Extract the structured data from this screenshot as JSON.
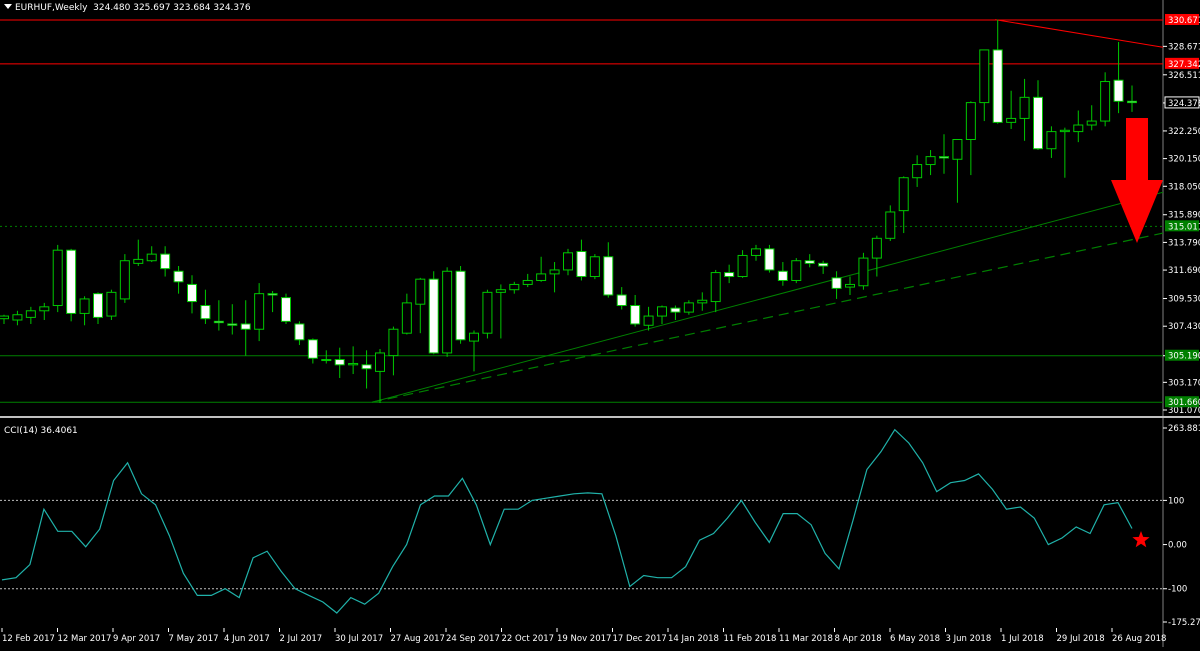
{
  "header": {
    "symbol": "EURHUF,Weekly",
    "ohlc": "324.480 325.697 323.684 324.376"
  },
  "price_axis": {
    "ticks": [
      "328.671",
      "326.511",
      "324.376",
      "322.250",
      "320.150",
      "318.050",
      "315.890",
      "313.790",
      "311.690",
      "309.530",
      "307.430",
      "305.190",
      "303.170",
      "301.070"
    ],
    "level_labels": [
      {
        "text": "330.671",
        "kind": "resistance",
        "color": "#ff0000"
      },
      {
        "text": "327.342",
        "kind": "resistance",
        "color": "#ff0000"
      },
      {
        "text": "315.011",
        "kind": "pivot",
        "color": "#008000"
      },
      {
        "text": "305.190",
        "kind": "support",
        "color": "#008000"
      },
      {
        "text": "301.660",
        "kind": "support",
        "color": "#008000"
      }
    ],
    "current_price": "324.376"
  },
  "cci": {
    "label": "CCI(14) 36.4061",
    "ticks": [
      "263.881",
      "100",
      "0.00",
      "-100",
      "-175.274"
    ]
  },
  "time_axis": {
    "labels": [
      "12 Feb 2017",
      "12 Mar 2017",
      "9 Apr 2017",
      "7 May 2017",
      "4 Jun 2017",
      "2 Jul 2017",
      "30 Jul 2017",
      "27 Aug 2017",
      "24 Sep 2017",
      "22 Oct 2017",
      "19 Nov 2017",
      "17 Dec 2017",
      "14 Jan 2018",
      "11 Feb 2018",
      "11 Mar 2018",
      "8 Apr 2018",
      "6 May 2018",
      "3 Jun 2018",
      "1 Jul 2018",
      "29 Jul 2018",
      "26 Aug 2018"
    ]
  },
  "colors": {
    "background": "#000000",
    "bull_body": "#000000",
    "bear_body": "#ffffff",
    "wick": "#00c800",
    "resistance": "#ff0000",
    "support": "#008000",
    "cci_line": "#20b2aa",
    "arrow": "#ff0000",
    "star": "#ff0000"
  },
  "chart_data": [
    {
      "type": "candlestick",
      "symbol": "EURHUF",
      "timeframe": "Weekly",
      "ylim": [
        301.07,
        330.67
      ],
      "candles": [
        [
          308.0,
          308.3,
          307.6,
          308.2
        ],
        [
          307.9,
          308.6,
          307.5,
          308.3
        ],
        [
          308.1,
          308.9,
          307.6,
          308.6
        ],
        [
          308.6,
          309.2,
          307.9,
          308.9
        ],
        [
          309.0,
          313.6,
          308.5,
          313.2
        ],
        [
          313.2,
          313.3,
          307.8,
          308.4
        ],
        [
          308.4,
          309.7,
          307.5,
          309.5
        ],
        [
          309.9,
          310.0,
          307.6,
          308.1
        ],
        [
          308.2,
          310.2,
          307.9,
          310.0
        ],
        [
          309.5,
          312.9,
          309.2,
          312.4
        ],
        [
          312.2,
          314.0,
          312.0,
          312.5
        ],
        [
          312.4,
          313.5,
          312.3,
          312.9
        ],
        [
          312.9,
          313.5,
          311.2,
          311.8
        ],
        [
          311.6,
          312.0,
          309.9,
          310.8
        ],
        [
          310.6,
          311.3,
          308.4,
          309.3
        ],
        [
          309.0,
          310.2,
          307.6,
          308.0
        ],
        [
          307.8,
          309.4,
          307.1,
          307.7
        ],
        [
          307.6,
          309.1,
          306.8,
          307.5
        ],
        [
          307.6,
          309.4,
          305.2,
          307.2
        ],
        [
          307.2,
          310.7,
          306.3,
          309.9
        ],
        [
          309.9,
          310.1,
          308.5,
          309.8
        ],
        [
          309.6,
          309.9,
          307.6,
          307.8
        ],
        [
          307.6,
          307.8,
          306.0,
          306.4
        ],
        [
          306.4,
          306.5,
          304.6,
          305.0
        ],
        [
          304.9,
          305.6,
          304.6,
          304.9
        ],
        [
          304.9,
          305.8,
          303.5,
          304.5
        ],
        [
          304.5,
          305.9,
          303.8,
          304.6
        ],
        [
          304.5,
          305.6,
          302.7,
          304.2
        ],
        [
          304.0,
          305.7,
          301.6,
          305.4
        ],
        [
          305.2,
          307.4,
          303.7,
          307.2
        ],
        [
          306.9,
          309.9,
          306.8,
          309.2
        ],
        [
          309.1,
          311.1,
          306.9,
          311.0
        ],
        [
          311.0,
          311.6,
          305.3,
          305.4
        ],
        [
          305.4,
          311.9,
          305.1,
          311.6
        ],
        [
          311.6,
          312.0,
          306.1,
          306.4
        ],
        [
          306.3,
          307.1,
          304.0,
          306.9
        ],
        [
          306.9,
          310.2,
          306.5,
          310.0
        ],
        [
          310.0,
          310.6,
          306.5,
          310.2
        ],
        [
          310.2,
          310.8,
          309.9,
          310.6
        ],
        [
          310.6,
          311.4,
          310.4,
          310.9
        ],
        [
          310.9,
          312.7,
          310.8,
          311.4
        ],
        [
          311.4,
          312.3,
          310.0,
          311.7
        ],
        [
          311.7,
          313.3,
          311.3,
          313.0
        ],
        [
          313.1,
          314.0,
          310.9,
          311.2
        ],
        [
          311.2,
          312.9,
          311.0,
          312.7
        ],
        [
          312.7,
          313.8,
          309.6,
          309.8
        ],
        [
          309.8,
          310.4,
          308.7,
          309.0
        ],
        [
          309.0,
          309.8,
          307.4,
          307.6
        ],
        [
          307.5,
          308.9,
          307.1,
          308.2
        ],
        [
          308.2,
          309.0,
          307.6,
          308.9
        ],
        [
          308.8,
          309.0,
          307.9,
          308.5
        ],
        [
          308.5,
          309.4,
          308.3,
          309.2
        ],
        [
          309.2,
          310.0,
          308.6,
          309.4
        ],
        [
          309.3,
          311.7,
          308.5,
          311.5
        ],
        [
          311.5,
          312.1,
          310.7,
          311.2
        ],
        [
          311.2,
          313.2,
          311.1,
          312.8
        ],
        [
          312.8,
          313.6,
          312.4,
          313.3
        ],
        [
          313.3,
          313.6,
          311.5,
          311.7
        ],
        [
          311.6,
          312.3,
          310.5,
          310.9
        ],
        [
          310.9,
          312.6,
          310.7,
          312.4
        ],
        [
          312.4,
          312.9,
          311.9,
          312.2
        ],
        [
          312.2,
          312.4,
          311.4,
          312.0
        ],
        [
          311.1,
          311.6,
          309.5,
          310.3
        ],
        [
          310.4,
          311.2,
          309.8,
          310.6
        ],
        [
          310.5,
          313.0,
          310.2,
          312.6
        ],
        [
          312.6,
          314.3,
          311.2,
          314.1
        ],
        [
          314.1,
          316.6,
          313.9,
          316.1
        ],
        [
          316.2,
          318.8,
          314.5,
          318.7
        ],
        [
          318.7,
          320.4,
          318.0,
          319.7
        ],
        [
          319.7,
          320.8,
          318.9,
          320.3
        ],
        [
          320.3,
          322.0,
          319.0,
          320.2
        ],
        [
          320.1,
          321.5,
          316.8,
          321.6
        ],
        [
          321.6,
          324.5,
          318.9,
          324.4
        ],
        [
          324.4,
          327.2,
          323.0,
          328.4
        ],
        [
          328.4,
          330.7,
          322.8,
          322.9
        ],
        [
          322.9,
          325.3,
          322.4,
          323.2
        ],
        [
          323.2,
          326.2,
          321.5,
          324.8
        ],
        [
          324.8,
          326.1,
          320.8,
          320.9
        ],
        [
          320.9,
          322.6,
          320.2,
          322.2
        ],
        [
          322.2,
          322.5,
          318.7,
          322.3
        ],
        [
          322.2,
          323.8,
          321.4,
          322.7
        ],
        [
          322.7,
          324.2,
          322.3,
          323.0
        ],
        [
          323.0,
          326.7,
          322.6,
          326.0
        ],
        [
          326.1,
          329.0,
          323.6,
          324.5
        ],
        [
          324.5,
          325.7,
          323.7,
          324.4
        ]
      ],
      "levels": {
        "resistance": [
          330.671,
          327.342
        ],
        "support": [
          315.011,
          305.19,
          301.66
        ]
      },
      "trendlines": [
        {
          "from": [
            301.66
          ],
          "to": [
            317.6
          ],
          "style": "solid",
          "color": "#008000"
        },
        {
          "from": [
            301.66
          ],
          "to": [
            314.5
          ],
          "style": "dashed",
          "color": "#008000"
        },
        {
          "from": [
            330.7
          ],
          "to": [
            328.6
          ],
          "style": "solid",
          "color": "#ff0000"
        }
      ]
    },
    {
      "type": "line",
      "indicator": "CCI(14)",
      "last_value": 36.4061,
      "ylim": [
        -175.274,
        263.881
      ],
      "reference_levels": [
        100,
        -100
      ],
      "values": [
        -80,
        -75,
        -45,
        80,
        30,
        30,
        -5,
        35,
        145,
        185,
        115,
        90,
        20,
        -65,
        -115,
        -115,
        -100,
        -120,
        -30,
        -15,
        -60,
        -100,
        -115,
        -130,
        -155,
        -120,
        -135,
        -110,
        -50,
        0,
        90,
        110,
        110,
        150,
        90,
        0,
        80,
        80,
        100,
        105,
        110,
        115,
        117,
        115,
        20,
        -95,
        -70,
        -75,
        -75,
        -50,
        10,
        25,
        60,
        100,
        50,
        5,
        70,
        70,
        45,
        -20,
        -55,
        55,
        170,
        210,
        260,
        230,
        185,
        120,
        140,
        145,
        160,
        125,
        80,
        85,
        60,
        0,
        15,
        40,
        25,
        90,
        95,
        36.4
      ]
    }
  ]
}
